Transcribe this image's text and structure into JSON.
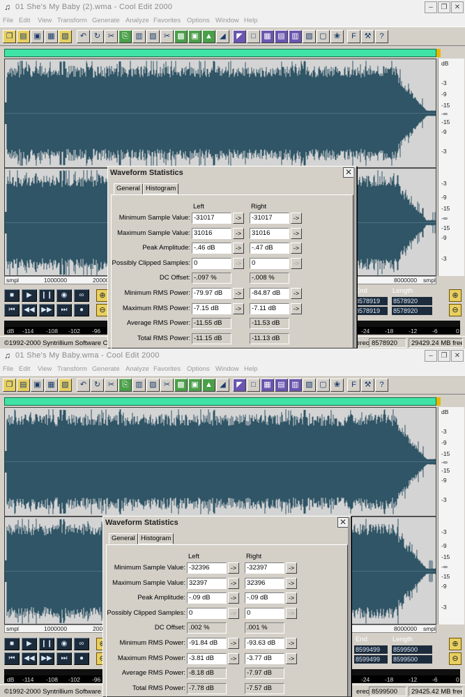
{
  "windows": [
    {
      "title": "01 She's My Baby (2).wma - Cool Edit 2000",
      "menu": [
        "File",
        "Edit",
        "View",
        "Transform",
        "Generate",
        "Analyze",
        "Favorites",
        "Options",
        "Window",
        "Help"
      ],
      "db_scale": [
        "dB",
        "-3",
        "-9",
        "-15",
        "-∞",
        "-15",
        "-9",
        "-3",
        "-3",
        "-9",
        "-15",
        "-∞",
        "-15",
        "-9",
        "-3"
      ],
      "ruler": {
        "start": "smpl",
        "marks": [
          "1000000",
          "2000000"
        ],
        "end_mark": "8000000",
        "end": "smpl"
      },
      "selection": {
        "end_label": "End",
        "length_label": "Length",
        "end_values": [
          "8578919",
          "8578919"
        ],
        "length_values": [
          "8578920",
          "8578920"
        ]
      },
      "level_labels": [
        "dB",
        "-114",
        "-108",
        "-102",
        "-96",
        "-24",
        "-18",
        "-12",
        "-6",
        "0"
      ],
      "status": {
        "copyright": "©1992-2000 Syntrillium Software Corp",
        "mode": "ereo",
        "samples": "8578920",
        "free": "29429.24 MB free"
      },
      "stats": {
        "title": "Waveform Statistics",
        "tabs": [
          "General",
          "Histogram"
        ],
        "left_header": "Left",
        "right_header": "Right",
        "rows": [
          {
            "label": "Minimum Sample Value:",
            "left": "-31017",
            "right": "-31017",
            "button": true,
            "enabled": true
          },
          {
            "label": "Maximum Sample Value:",
            "left": "31016",
            "right": "31016",
            "button": true,
            "enabled": true
          },
          {
            "label": "Peak Amplitude:",
            "left": "-.46 dB",
            "right": "-.47 dB",
            "button": true,
            "enabled": true
          },
          {
            "label": "Possibly Clipped Samples:",
            "left": "0",
            "right": "0",
            "button": true,
            "enabled": false
          },
          {
            "label": "DC Offset:",
            "left": "-.097 %",
            "right": "-.008 %",
            "button": false,
            "enabled": false
          },
          {
            "label": "Minimum RMS Power:",
            "left": "-79.97 dB",
            "right": "-84.87 dB",
            "button": true,
            "enabled": true
          },
          {
            "label": "Maximum RMS Power:",
            "left": "-7.15 dB",
            "right": "-7.11 dB",
            "button": true,
            "enabled": true
          },
          {
            "label": "Average RMS Power:",
            "left": "-11.55 dB",
            "right": "-11.53 dB",
            "button": false,
            "enabled": false
          },
          {
            "label": "Total RMS Power:",
            "left": "-11.15 dB",
            "right": "-11.13 dB",
            "button": false,
            "enabled": false
          }
        ]
      }
    },
    {
      "title": "01 She's My Baby.wma - Cool Edit 2000",
      "menu": [
        "File",
        "Edit",
        "View",
        "Transform",
        "Generate",
        "Analyze",
        "Favorites",
        "Options",
        "Window",
        "Help"
      ],
      "db_scale": [
        "dB",
        "-3",
        "-9",
        "-15",
        "-∞",
        "-15",
        "-9",
        "-3",
        "-3",
        "-9",
        "-15",
        "-∞",
        "-15",
        "-9",
        "-3"
      ],
      "ruler": {
        "start": "smpl",
        "marks": [
          "1000000",
          "2000000"
        ],
        "end_mark": "8000000",
        "end": "smpl"
      },
      "selection": {
        "end_label": "End",
        "length_label": "Length",
        "end_values": [
          "8599499",
          "8599499"
        ],
        "length_values": [
          "8599500",
          "8599500"
        ]
      },
      "level_labels": [
        "dB",
        "-114",
        "-108",
        "-102",
        "-96",
        "-24",
        "-18",
        "-12",
        "-6",
        "0"
      ],
      "status": {
        "copyright": "©1992-2000 Syntrillium Software Co",
        "mode": "ereo",
        "samples": "8599500",
        "free": "29425.42 MB free"
      },
      "stats": {
        "title": "Waveform Statistics",
        "tabs": [
          "General",
          "Histogram"
        ],
        "left_header": "Left",
        "right_header": "Right",
        "rows": [
          {
            "label": "Minimum Sample Value:",
            "left": "-32396",
            "right": "-32397",
            "button": true,
            "enabled": true
          },
          {
            "label": "Maximum Sample Value:",
            "left": "32397",
            "right": "32396",
            "button": true,
            "enabled": true
          },
          {
            "label": "Peak Amplitude:",
            "left": "-.09 dB",
            "right": "-.09 dB",
            "button": true,
            "enabled": true
          },
          {
            "label": "Possibly Clipped Samples:",
            "left": "0",
            "right": "0",
            "button": true,
            "enabled": false
          },
          {
            "label": "DC Offset:",
            "left": ".002 %",
            "right": ".001 %",
            "button": false,
            "enabled": false
          },
          {
            "label": "Minimum RMS Power:",
            "left": "-91.84 dB",
            "right": "-93.63 dB",
            "button": true,
            "enabled": true
          },
          {
            "label": "Maximum RMS Power:",
            "left": "-3.81 dB",
            "right": "-3.77 dB",
            "button": true,
            "enabled": true
          },
          {
            "label": "Average RMS Power:",
            "left": "-8.18 dB",
            "right": "-7.97 dB",
            "button": false,
            "enabled": false
          },
          {
            "label": "Total RMS Power:",
            "left": "-7.78 dB",
            "right": "-7.57 dB",
            "button": false,
            "enabled": false
          }
        ]
      }
    }
  ],
  "icons": {
    "app": "speaker-icon",
    "minimize": "minimize-icon",
    "maximize": "restore-icon",
    "close": "close-icon",
    "arrow": "->"
  },
  "colors": {
    "waveform": "#2f5566",
    "overview": "#3fe3a6",
    "transport": "#1c2c3c"
  }
}
